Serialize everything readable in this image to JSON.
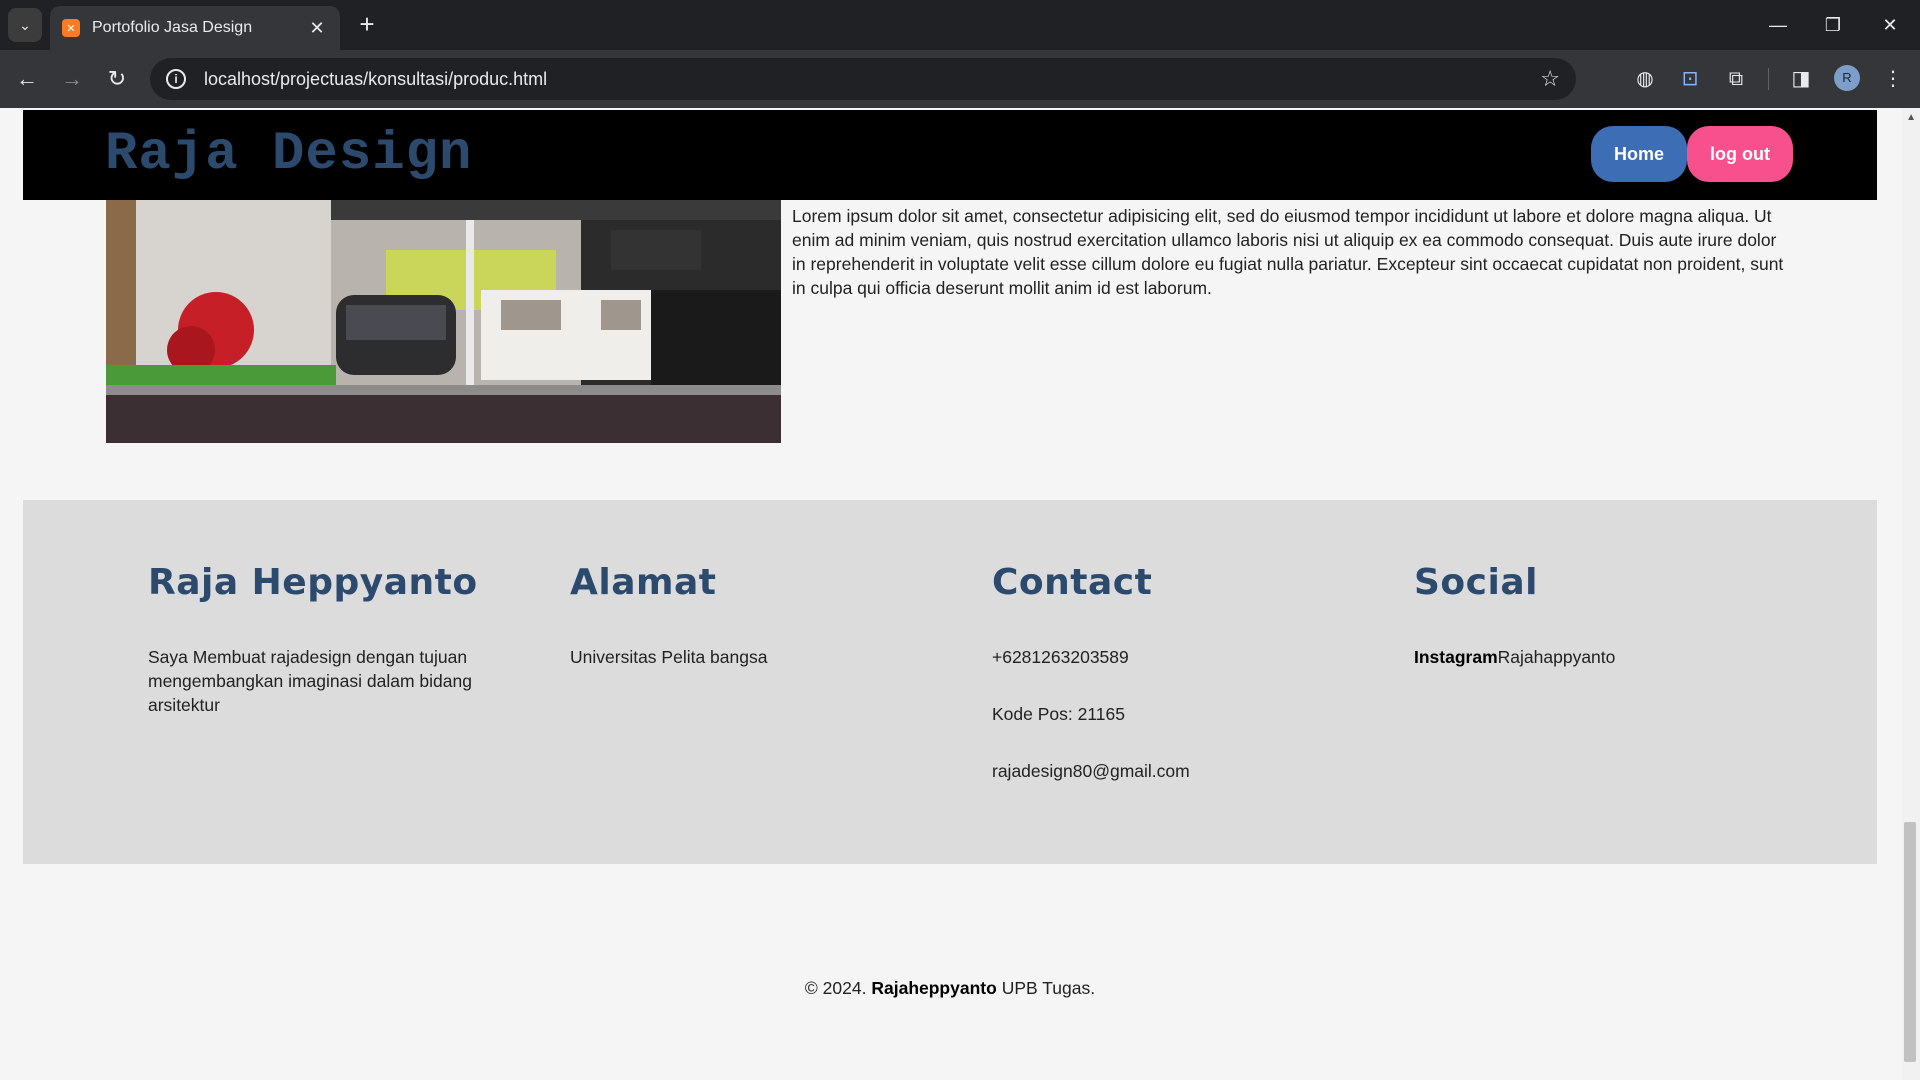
{
  "browser": {
    "tab_title": "Portofolio Jasa Design",
    "url": "localhost/projectuas/konsultasi/produc.html",
    "profile_initial": "R"
  },
  "site": {
    "brand": "Raja Design",
    "nav": {
      "home": "Home",
      "logout": "log out"
    },
    "intro_text": "Lorem ipsum dolor sit amet, consectetur adipisicing elit, sed do eiusmod tempor incididunt ut labore et dolore magna aliqua. Ut enim ad minim veniam, quis nostrud exercitation ullamco laboris nisi ut aliquip ex ea commodo consequat. Duis aute irure dolor in reprehenderit in voluptate velit esse cillum dolore eu fugiat nulla pariatur. Excepteur sint occaecat cupidatat non proident, sunt in culpa qui officia deserunt mollit anim id est laborum."
  },
  "footer": {
    "about": {
      "title": "Raja Heppyanto",
      "text": "Saya Membuat rajadesign dengan tujuan mengembangkan imaginasi dalam bidang arsitektur"
    },
    "address": {
      "title": "Alamat",
      "text": "Universitas Pelita bangsa"
    },
    "contact": {
      "title": "Contact",
      "phone": "+6281263203589",
      "postal": "Kode Pos: 21165",
      "email": "rajadesign80@gmail.com"
    },
    "social": {
      "title": "Social",
      "label": "Instagram",
      "handle": "Rajahappyanto"
    },
    "copyright": {
      "prefix": "© 2024.",
      "name": "Rajaheppyanto",
      "suffix": "UPB Tugas."
    }
  },
  "colors": {
    "brand": "#2c4a6e",
    "home_button": "#3d6eb5",
    "logout_button": "#f8508c",
    "footer_bg": "#dcdcdc"
  }
}
